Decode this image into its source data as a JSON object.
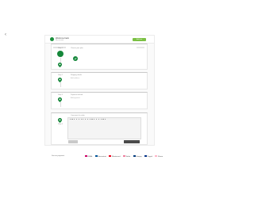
{
  "topbar": {
    "user_name": "Welcome back",
    "user_sub": "My account",
    "cta_label": "Add new"
  },
  "steps": [
    {
      "label": "Step 1",
      "sub": "Choose your plan",
      "detail": ""
    },
    {
      "label": "Step 2",
      "sub": "Shipping details",
      "detail": "Add address"
    },
    {
      "label": "Step 3",
      "sub": "Payment method",
      "detail": "Add payment"
    },
    {
      "label": "Step 4",
      "sub": "Comments for order",
      "detail": ""
    }
  ],
  "footer": {
    "label": "Secure payment",
    "payments": [
      {
        "name": "iDEAL",
        "color": "#cc0066"
      },
      {
        "name": "Bancontact",
        "color": "#005498"
      },
      {
        "name": "Mastercard",
        "color": "#eb001b"
      },
      {
        "name": "Sofort",
        "color": "#ef809f"
      },
      {
        "name": "Giropay",
        "color": "#003a7d"
      },
      {
        "name": "Paypal",
        "color": "#003087"
      },
      {
        "name": "Klarna",
        "color": "#ffb3c7"
      }
    ]
  },
  "colors": {
    "brand": "#15873a",
    "accent": "#7bc043"
  }
}
